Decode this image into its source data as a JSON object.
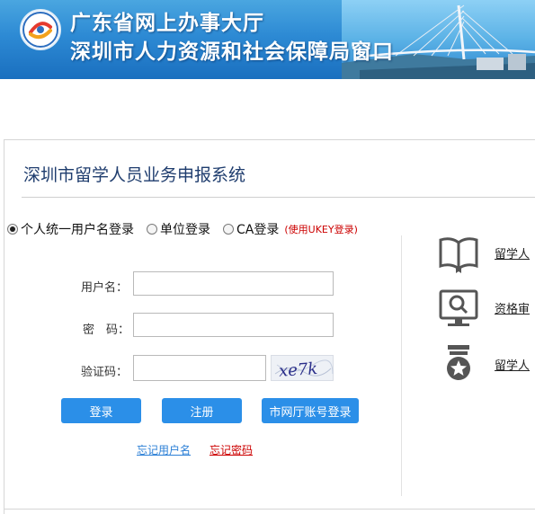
{
  "header": {
    "title_line1": "广东省网上办事大厅",
    "title_line2": "深圳市人力资源和社会保障局窗口",
    "logo_icon": "emblem-logo-icon",
    "banner_colors": {
      "top": "#4aa6e0",
      "bottom": "#1a6fbf"
    }
  },
  "main": {
    "system_title": "深圳市留学人员业务申报系统",
    "login_types": [
      {
        "label": "个人统一用户名登录",
        "checked": true
      },
      {
        "label": "单位登录",
        "checked": false
      },
      {
        "label": "CA登录",
        "checked": false
      }
    ],
    "ukey_note": "(使用UKEY登录)",
    "form": {
      "username_label": "用户名：",
      "username_value": "",
      "password_label": "密　码：",
      "password_value": "",
      "captcha_label": "验证码：",
      "captcha_value": "",
      "captcha_text": "xe7k"
    },
    "buttons": {
      "login": "登录",
      "register": "注册",
      "city_login": "市网厅账号登录"
    },
    "links": {
      "forgot_username": "忘记用户名",
      "forgot_password": "忘记密码"
    },
    "colors": {
      "button": "#2b8fe8",
      "title": "#1f3d6e",
      "forgot_username": "#2b7fd6",
      "forgot_password": "#cc0000",
      "ukey_note": "#cc0000"
    }
  },
  "services": [
    {
      "icon": "open-book-icon",
      "label": "留学人"
    },
    {
      "icon": "monitor-search-icon",
      "label": "资格审"
    },
    {
      "icon": "medal-star-icon",
      "label": "留学人"
    }
  ]
}
